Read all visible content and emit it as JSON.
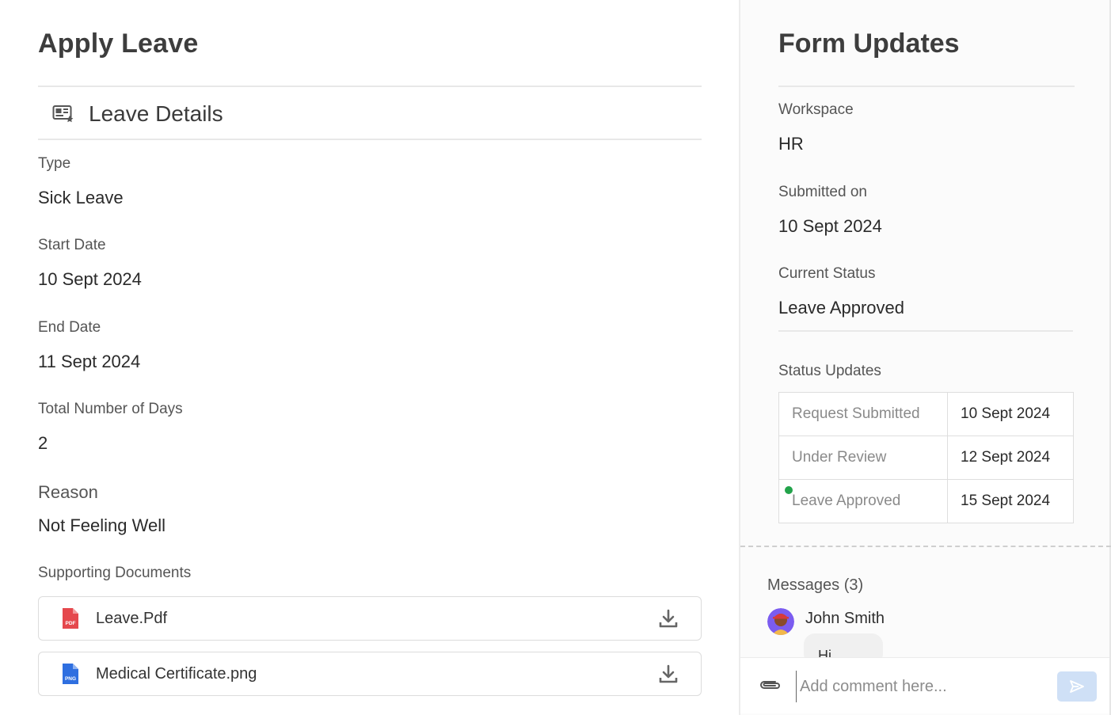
{
  "left": {
    "title": "Apply Leave",
    "section_title": "Leave Details",
    "fields": {
      "type_label": "Type",
      "type_value": "Sick Leave",
      "start_label": "Start Date",
      "start_value": "10 Sept 2024",
      "end_label": "End Date",
      "end_value": "11 Sept 2024",
      "days_label": "Total Number of Days",
      "days_value": "2",
      "reason_label": "Reason",
      "reason_value": "Not Feeling Well",
      "docs_label": "Supporting Documents"
    },
    "documents": [
      {
        "name": "Leave.Pdf",
        "icon": "pdf-file-icon",
        "badge": "PDF",
        "color": "#e5484d"
      },
      {
        "name": "Medical Certificate.png",
        "icon": "png-file-icon",
        "badge": "PNG",
        "color": "#2f6fe0"
      }
    ]
  },
  "right": {
    "title": "Form Updates",
    "workspace_label": "Workspace",
    "workspace_value": "HR",
    "submitted_label": "Submitted on",
    "submitted_value": "10 Sept 2024",
    "status_label": "Current Status",
    "status_value": "Leave Approved",
    "updates_label": "Status Updates",
    "updates": [
      {
        "stage": "Request Submitted",
        "date": "10 Sept 2024"
      },
      {
        "stage": "Under Review",
        "date": "12 Sept 2024"
      },
      {
        "stage": "Leave Approved",
        "date": "15 Sept 2024",
        "current": true
      }
    ],
    "messages_label": "Messages (3)",
    "message_user": "John Smith",
    "message_text": "Hi",
    "comment_placeholder": "Add comment here...",
    "accent_color": "#22a34a",
    "send_button_color": "#cfe0f6"
  }
}
